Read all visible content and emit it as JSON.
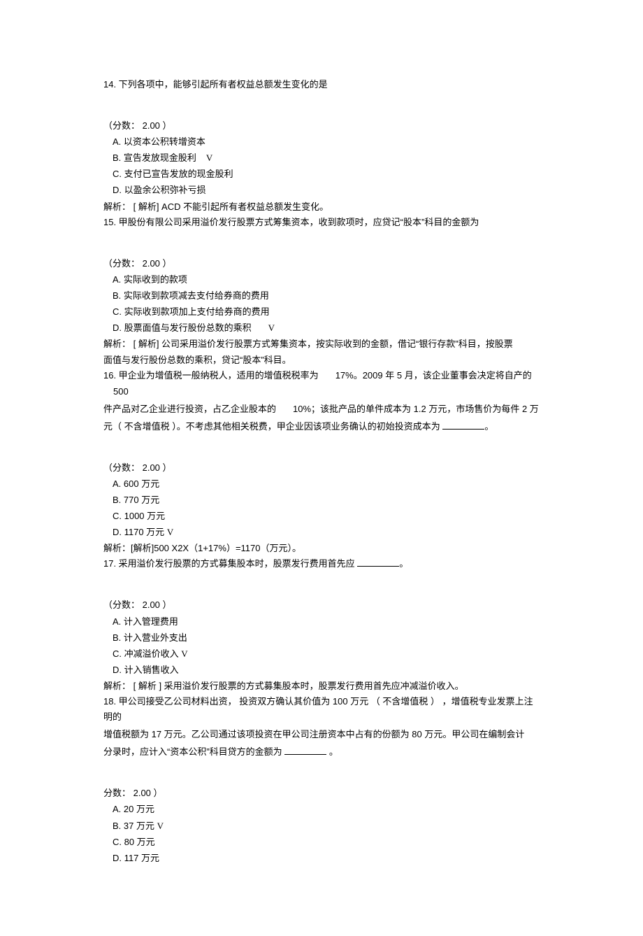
{
  "q14": {
    "stem": "14.  下列各项中，能够引起所有者权益总额发生变化的是",
    "score": "（分数：  2.00 ）",
    "A": " A.  以资本公积转增资本",
    "B_pre": " B.  宣告发放现金股利",
    "B_mark": "V",
    "C": " C.  支付已宣告发放的现金股利",
    "D": " D.  以盈余公积弥补亏损",
    "analysis": "解析：  [ 解析] ACD 不能引起所有者权益总额发生变化。"
  },
  "q15": {
    "stem": "15.  甲股份有限公司采用溢价发行股票方式筹集资本，收到款项时，应贷记“股本”科目的金额为",
    "score": "（分数：  2.00 ）",
    "A": " A.  实际收到的款项",
    "B": " B.  实际收到款项减去支付给券商的费用",
    "C": " C.  实际收到款项加上支付给券商的费用",
    "D_pre": " D.  股票面值与发行股份总数的乘积",
    "D_mark": "V",
    "analysis1": "解析：  [ 解析] 公司采用溢价发行股票方式筹集资本，按实际收到的金额，借记“银行存款”科目，按股票",
    "analysis2": "面值与发行股份总数的乘积，贷记“股本”科目。"
  },
  "q16": {
    "line1a": "16.  甲企业为增值税一般纳税人，适用的增值税税率为",
    "line1b": "17%。2009 年 5 月，该企业董事会决定将自产的",
    "line1c": "500",
    "line2a": "件产品对乙企业进行投资，占乙企业股本的",
    "line2b": "10%；该批产品的单件成本为 1.2 万元，市场售价为每件 2 万",
    "line3a": "元（ 不含增值税  ）。不考虑其他相关税费，甲企业因该项业务确认的初始投资成本为 ",
    "line3b": "。",
    "score": "（分数：  2.00 ）",
    "A": " A.  600 万元",
    "B": " B.  770 万元",
    "C": " C.  1000 万元",
    "D_pre": " D.  1170 万元",
    "D_mark": "V",
    "analysis": "解析：[解析]500 X2X（1+17%）=1170（万元）。"
  },
  "q17": {
    "stem_a": "17.  采用溢价发行股票的方式募集股本时，股票发行费用首先应 ",
    "stem_b": "。",
    "score": "（分数：  2.00 ）",
    "A": " A.  计入管理费用",
    "B": " B.  计入营业外支出",
    "C_pre": " C.  冲减溢价收入",
    "C_mark": "V",
    "D": " D.  计入销售收入",
    "analysis": "解析：  [ 解析  ] 采用溢价发行股票的方式募集股本时，股票发行费用首先应冲减溢价收入。"
  },
  "q18": {
    "line1": "18.  甲公司接受乙公司材料出资，  投资双方确认其价值为 100 万元  （ 不含增值税  ） ，增值税专业发票上注明的",
    "line2": "增值税额为 17 万元。乙公司通过该项投资在甲公司注册资本中占有的份额为 80 万元。甲公司在编制会计",
    "line3a": "分录时，应计入“资本公积”科目贷方的金额为 ",
    "line3b": "  。",
    "score": " 分数：  2.00 ）",
    "A": " A.  20 万元",
    "B_pre": " B.  37 万元",
    "B_mark": "V",
    "C": " C.  80 万元",
    "D": " D.  117 万元"
  }
}
